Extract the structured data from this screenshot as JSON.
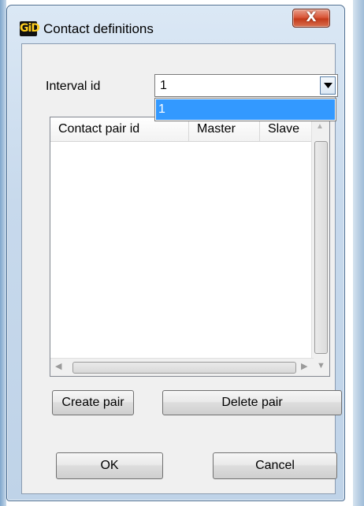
{
  "window": {
    "title": "Contact definitions",
    "app_icon_text": "GiD",
    "close_glyph": "X"
  },
  "interval": {
    "label": "Interval id",
    "selected_value": "1",
    "dropdown_options": [
      "1"
    ]
  },
  "table": {
    "columns": [
      "Contact pair id",
      "Master",
      "Slave"
    ],
    "rows": []
  },
  "buttons": {
    "create_pair": "Create pair",
    "delete_pair": "Delete pair",
    "ok": "OK",
    "cancel": "Cancel"
  },
  "colors": {
    "selection": "#3399ff",
    "close_button": "#c43a1a",
    "title_bar": "#c7d9ec"
  },
  "icons": [
    "gid-logo-icon",
    "close-icon",
    "chevron-down-icon"
  ]
}
